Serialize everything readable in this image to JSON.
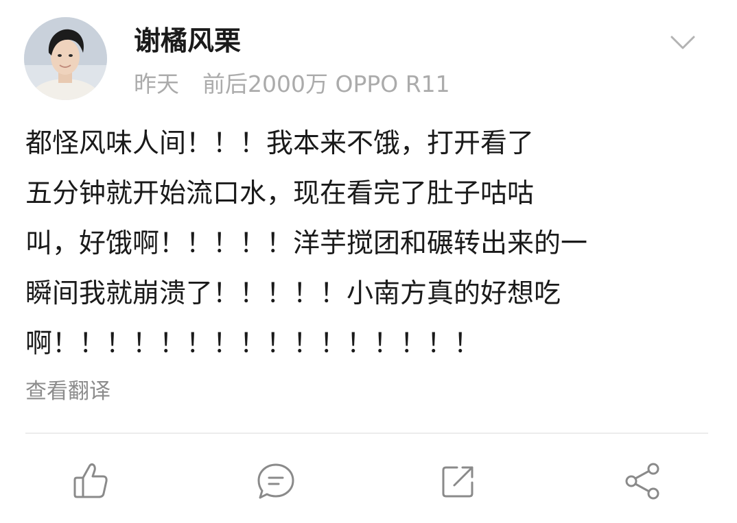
{
  "post": {
    "author": {
      "name": "谢橘风栗",
      "avatar_icon": "user-avatar"
    },
    "meta": {
      "time": "昨天",
      "source": "前后2000万 OPPO R11"
    },
    "menu_icon": "chevron-down-icon",
    "content_lines": [
      "都怪风味人间！！！我本来不饿，打开看了",
      "五分钟就开始流口水，现在看完了肚子咕咕",
      "叫，好饿啊！！！！！洋芋搅团和碾转出来的一",
      "瞬间我就崩溃了！！！！！小南方真的好想吃",
      "啊！！！！！！！！！！！！！！！！"
    ],
    "translate_label": "查看翻译"
  },
  "actions": [
    {
      "name": "like",
      "icon": "thumbs-up-icon"
    },
    {
      "name": "comment",
      "icon": "comment-icon"
    },
    {
      "name": "repost",
      "icon": "repost-icon"
    },
    {
      "name": "share",
      "icon": "share-icon"
    }
  ],
  "colors": {
    "text": "#1a1a1a",
    "meta": "#ababab",
    "translate": "#8c8c8c",
    "icon": "#8a8a8a",
    "divider": "#ececec"
  }
}
